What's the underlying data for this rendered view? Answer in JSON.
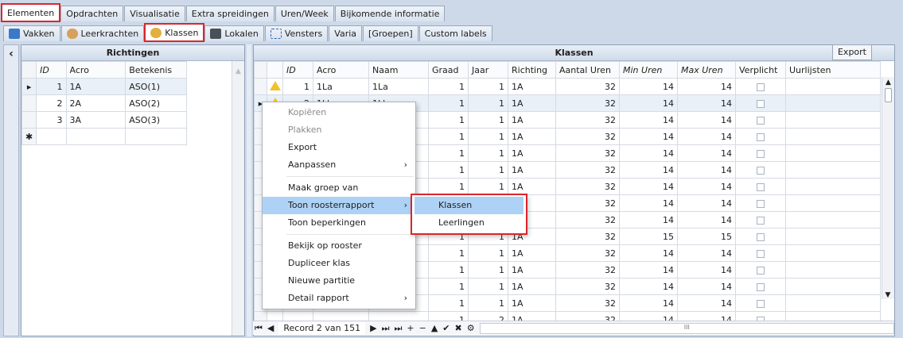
{
  "tabs_top": [
    {
      "label": "Elementen"
    },
    {
      "label": "Opdrachten"
    },
    {
      "label": "Visualisatie"
    },
    {
      "label": "Extra spreidingen"
    },
    {
      "label": "Uren/Week"
    },
    {
      "label": "Bijkomende informatie"
    }
  ],
  "tabs_second": [
    {
      "label": "Vakken"
    },
    {
      "label": "Leerkrachten"
    },
    {
      "label": "Klassen"
    },
    {
      "label": "Lokalen"
    },
    {
      "label": "Vensters"
    },
    {
      "label": "Varia"
    },
    {
      "label": "[Groepen]"
    },
    {
      "label": "Custom labels"
    }
  ],
  "collapse_glyph": "‹",
  "richtingen": {
    "title": "Richtingen",
    "columns": [
      "ID",
      "Acro",
      "Betekenis"
    ],
    "rows": [
      {
        "id": "1",
        "acro": "1A",
        "betekenis": "ASO(1)"
      },
      {
        "id": "2",
        "acro": "2A",
        "betekenis": "ASO(2)"
      },
      {
        "id": "3",
        "acro": "3A",
        "betekenis": "ASO(3)"
      }
    ],
    "new_row_glyph": "✱"
  },
  "klassen": {
    "title": "Klassen",
    "export_label": "Export",
    "columns": [
      "ID",
      "Acro",
      "Naam",
      "Graad",
      "Jaar",
      "Richting",
      "Aantal Uren",
      "Min Uren",
      "Max Uren",
      "Verplicht",
      "Uurlijsten"
    ],
    "rows": [
      {
        "id": "1",
        "acro": "1La",
        "naam": "1La",
        "graad": "1",
        "jaar": "1",
        "richting": "1A",
        "aantal": "32",
        "min": "14",
        "max": "14"
      },
      {
        "id": "2",
        "acro": "1Lb",
        "naam": "1Lb",
        "graad": "1",
        "jaar": "1",
        "richting": "1A",
        "aantal": "32",
        "min": "14",
        "max": "14"
      },
      {
        "id": "",
        "acro": "",
        "naam": "",
        "graad": "1",
        "jaar": "1",
        "richting": "1A",
        "aantal": "32",
        "min": "14",
        "max": "14"
      },
      {
        "id": "",
        "acro": "",
        "naam": "",
        "graad": "1",
        "jaar": "1",
        "richting": "1A",
        "aantal": "32",
        "min": "14",
        "max": "14"
      },
      {
        "id": "",
        "acro": "",
        "naam": "",
        "graad": "1",
        "jaar": "1",
        "richting": "1A",
        "aantal": "32",
        "min": "14",
        "max": "14"
      },
      {
        "id": "",
        "acro": "",
        "naam": "",
        "graad": "1",
        "jaar": "1",
        "richting": "1A",
        "aantal": "32",
        "min": "14",
        "max": "14"
      },
      {
        "id": "",
        "acro": "",
        "naam": "",
        "graad": "1",
        "jaar": "1",
        "richting": "1A",
        "aantal": "32",
        "min": "14",
        "max": "14"
      },
      {
        "id": "",
        "acro": "",
        "naam": "",
        "graad": "1",
        "jaar": "1",
        "richting": "1A",
        "aantal": "32",
        "min": "14",
        "max": "14"
      },
      {
        "id": "",
        "acro": "",
        "naam": "",
        "graad": "1",
        "jaar": "1",
        "richting": "1A",
        "aantal": "32",
        "min": "14",
        "max": "14"
      },
      {
        "id": "",
        "acro": "",
        "naam": "",
        "graad": "1",
        "jaar": "1",
        "richting": "1A",
        "aantal": "32",
        "min": "15",
        "max": "15"
      },
      {
        "id": "",
        "acro": "",
        "naam": "",
        "graad": "1",
        "jaar": "1",
        "richting": "1A",
        "aantal": "32",
        "min": "14",
        "max": "14"
      },
      {
        "id": "",
        "acro": "",
        "naam": "",
        "graad": "1",
        "jaar": "1",
        "richting": "1A",
        "aantal": "32",
        "min": "14",
        "max": "14"
      },
      {
        "id": "",
        "acro": "",
        "naam": "",
        "graad": "1",
        "jaar": "1",
        "richting": "1A",
        "aantal": "32",
        "min": "14",
        "max": "14"
      },
      {
        "id": "",
        "acro": "",
        "naam": "",
        "graad": "1",
        "jaar": "1",
        "richting": "1A",
        "aantal": "32",
        "min": "14",
        "max": "14"
      },
      {
        "id": "",
        "acro": "",
        "naam": "",
        "graad": "1",
        "jaar": "2",
        "richting": "1A",
        "aantal": "32",
        "min": "14",
        "max": "14"
      }
    ]
  },
  "navigator": {
    "record_text": "Record 2 van 151",
    "nav_glyphs": [
      "⏮",
      "◀",
      "▶",
      "⏭",
      "⏭",
      "+",
      "−",
      "▲",
      "✔",
      "✖",
      "⚙"
    ],
    "scroll_grip": "III"
  },
  "context_menu": {
    "items": [
      {
        "label": "Kopiëren",
        "disabled": true
      },
      {
        "label": "Plakken",
        "disabled": true
      },
      {
        "label": "Export"
      },
      {
        "label": "Aanpassen",
        "submenu": true
      },
      {
        "sep": true
      },
      {
        "label": "Maak groep van"
      },
      {
        "label": "Toon roosterrapport",
        "submenu": true,
        "hover": true
      },
      {
        "label": "Toon beperkingen"
      },
      {
        "sep": true
      },
      {
        "label": "Bekijk op rooster"
      },
      {
        "label": "Dupliceer klas"
      },
      {
        "label": "Nieuwe partitie"
      },
      {
        "label": "Detail rapport",
        "submenu": true
      }
    ],
    "arrow": "›"
  },
  "submenu": {
    "items": [
      {
        "label": "Klassen",
        "hover": true
      },
      {
        "label": "Leerlingen"
      }
    ]
  },
  "colors": {
    "highlight": "#d9262c",
    "menu_hover": "#aed2f5",
    "warning": "#f2c12e"
  }
}
